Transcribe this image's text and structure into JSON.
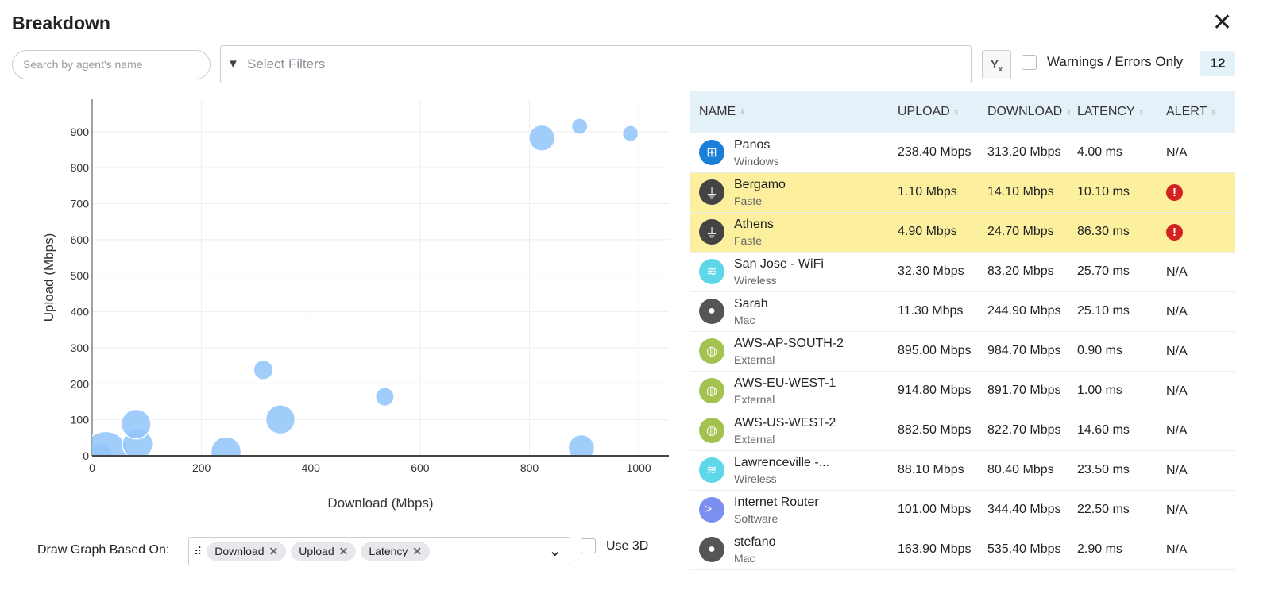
{
  "header": {
    "title": "Breakdown",
    "close_icon": "close-icon"
  },
  "toolbar": {
    "search_placeholder": "Search by agent's name",
    "filters_placeholder": "Select Filters",
    "warnings_label": "Warnings / Errors Only",
    "count": "12"
  },
  "table": {
    "columns": [
      "NAME",
      "UPLOAD",
      "DOWNLOAD",
      "LATENCY",
      "ALERT"
    ],
    "rows": [
      {
        "name": "Panos",
        "type": "Windows",
        "icon": "windows-icon",
        "color": "#1a7fd8",
        "upload": "238.40 Mbps",
        "download": "313.20 Mbps",
        "latency": "4.00 ms",
        "alert": "N/A",
        "warn": false
      },
      {
        "name": "Bergamo",
        "type": "Faste",
        "icon": "plug-icon",
        "color": "#444444",
        "upload": "1.10 Mbps",
        "download": "14.10 Mbps",
        "latency": "10.10 ms",
        "alert": "!",
        "warn": true
      },
      {
        "name": "Athens",
        "type": "Faste",
        "icon": "plug-icon",
        "color": "#444444",
        "upload": "4.90 Mbps",
        "download": "24.70 Mbps",
        "latency": "86.30 ms",
        "alert": "!",
        "warn": true
      },
      {
        "name": "San Jose - WiFi",
        "type": "Wireless",
        "icon": "wifi-icon",
        "color": "#5ed8e8",
        "upload": "32.30 Mbps",
        "download": "83.20 Mbps",
        "latency": "25.70 ms",
        "alert": "N/A",
        "warn": false
      },
      {
        "name": "Sarah",
        "type": "Mac",
        "icon": "apple-icon",
        "color": "#555555",
        "upload": "11.30 Mbps",
        "download": "244.90 Mbps",
        "latency": "25.10 ms",
        "alert": "N/A",
        "warn": false
      },
      {
        "name": "AWS-AP-SOUTH-2",
        "type": "External",
        "icon": "globe-icon",
        "color": "#a3c24f",
        "upload": "895.00 Mbps",
        "download": "984.70 Mbps",
        "latency": "0.90 ms",
        "alert": "N/A",
        "warn": false
      },
      {
        "name": "AWS-EU-WEST-1",
        "type": "External",
        "icon": "globe-icon",
        "color": "#a3c24f",
        "upload": "914.80 Mbps",
        "download": "891.70 Mbps",
        "latency": "1.00 ms",
        "alert": "N/A",
        "warn": false
      },
      {
        "name": "AWS-US-WEST-2",
        "type": "External",
        "icon": "globe-icon",
        "color": "#a3c24f",
        "upload": "882.50 Mbps",
        "download": "822.70 Mbps",
        "latency": "14.60 ms",
        "alert": "N/A",
        "warn": false
      },
      {
        "name": "Lawrenceville -...",
        "type": "Wireless",
        "icon": "wifi-icon",
        "color": "#5ed8e8",
        "upload": "88.10 Mbps",
        "download": "80.40 Mbps",
        "latency": "23.50 ms",
        "alert": "N/A",
        "warn": false
      },
      {
        "name": "Internet Router",
        "type": "Software",
        "icon": "terminal-icon",
        "color": "#7b8ff0",
        "upload": "101.00 Mbps",
        "download": "344.40 Mbps",
        "latency": "22.50 ms",
        "alert": "N/A",
        "warn": false
      },
      {
        "name": "stefano",
        "type": "Mac",
        "icon": "apple-icon",
        "color": "#555555",
        "upload": "163.90 Mbps",
        "download": "535.40 Mbps",
        "latency": "2.90 ms",
        "alert": "N/A",
        "warn": false
      }
    ]
  },
  "chart_data": {
    "type": "scatter",
    "xlabel": "Download (Mbps)",
    "ylabel": "Upload (Mbps)",
    "xlim": [
      0,
      1055
    ],
    "ylim": [
      0,
      990
    ],
    "xticks": [
      "0",
      "200",
      "400",
      "600",
      "800",
      "1000"
    ],
    "yticks": [
      "0",
      "100",
      "200",
      "300",
      "400",
      "500",
      "600",
      "700",
      "800",
      "900"
    ],
    "grid": true,
    "color": "#90c4fa",
    "points": [
      {
        "x": 313.2,
        "y": 238.4,
        "size": 4.0
      },
      {
        "x": 14.1,
        "y": 1.1,
        "size": 10.1
      },
      {
        "x": 24.7,
        "y": 4.9,
        "size": 86.3
      },
      {
        "x": 83.2,
        "y": 32.3,
        "size": 25.7
      },
      {
        "x": 244.9,
        "y": 11.3,
        "size": 25.1
      },
      {
        "x": 984.7,
        "y": 895.0,
        "size": 0.9
      },
      {
        "x": 891.7,
        "y": 914.8,
        "size": 1.0
      },
      {
        "x": 822.7,
        "y": 882.5,
        "size": 14.6
      },
      {
        "x": 80.4,
        "y": 88.1,
        "size": 23.5
      },
      {
        "x": 344.4,
        "y": 101.0,
        "size": 22.5
      },
      {
        "x": 535.4,
        "y": 163.9,
        "size": 2.9
      },
      {
        "x": 895,
        "y": 22,
        "size": 15
      }
    ]
  },
  "graph_options": {
    "label": "Draw Graph Based On:",
    "chips": [
      "Download",
      "Upload",
      "Latency"
    ],
    "use3d_label": "Use 3D"
  }
}
